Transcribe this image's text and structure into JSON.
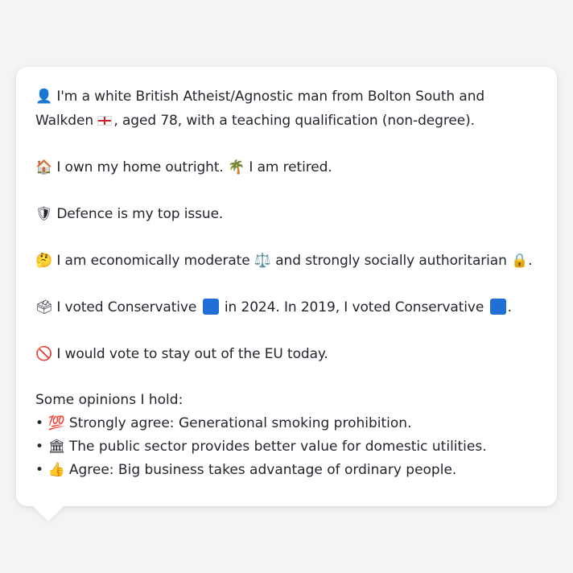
{
  "profile": {
    "intro": {
      "icon": "👤",
      "text_a": "I'm a white British Atheist/Agnostic man from Bolton South and Walkden",
      "flag_icon": "england-flag",
      "text_b": ", aged 78, with a teaching qualification (non-degree)."
    },
    "housing": {
      "icon": "🏠",
      "text_a": "I own my home outright.",
      "icon2": "🌴",
      "text_b": "I am retired."
    },
    "top_issue": {
      "icon": "🛡",
      "text": "Defence is my top issue."
    },
    "ideology": {
      "icon": "🤔",
      "text_a": "I am economically moderate",
      "icon2": "⚖️",
      "text_b": "and strongly socially authoritarian",
      "icon3": "🔒",
      "text_c": "."
    },
    "voting": {
      "icon": "🗳",
      "text_a": "I voted Conservative",
      "text_b": "in 2024. In 2019, I voted Conservative",
      "text_c": ".",
      "party_color": "#1f6fd6"
    },
    "eu": {
      "icon": "🚫",
      "text": "I would vote to stay out of the EU today."
    },
    "opinions": {
      "heading": "Some opinions I hold:",
      "bullet": "•",
      "items": [
        {
          "icon": "💯",
          "text": "Strongly agree: Generational smoking prohibition."
        },
        {
          "icon": "🏛",
          "text": "The public sector provides better value for domestic utilities."
        },
        {
          "icon": "👍",
          "text": "Agree: Big business takes advantage of ordinary people."
        }
      ]
    }
  }
}
